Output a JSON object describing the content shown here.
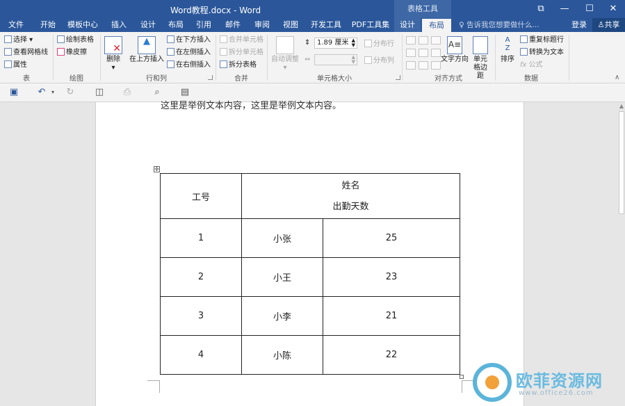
{
  "window": {
    "title": "Word教程.docx - Word",
    "context_group": "表格工具",
    "controls": [
      "ribbon-display-icon",
      "minimize-icon",
      "maximize-icon",
      "close-icon"
    ]
  },
  "tabs": [
    {
      "label": "文件"
    },
    {
      "label": "开始"
    },
    {
      "label": "模板中心"
    },
    {
      "label": "插入"
    },
    {
      "label": "设计"
    },
    {
      "label": "布局"
    },
    {
      "label": "引用"
    },
    {
      "label": "邮件"
    },
    {
      "label": "审阅"
    },
    {
      "label": "视图"
    },
    {
      "label": "开发工具"
    },
    {
      "label": "PDF工具集"
    },
    {
      "label": "设计"
    },
    {
      "label": "布局"
    }
  ],
  "tell_me": "告诉我您想要做什么...",
  "login": "登录",
  "share": "共享",
  "ribbon": {
    "table_group": {
      "label": "表",
      "select": "选择",
      "gridlines": "查看网格线",
      "properties": "属性"
    },
    "draw_group": {
      "label": "绘图",
      "draw_table": "绘制表格",
      "eraser": "橡皮擦"
    },
    "rows_cols_group": {
      "label": "行和列",
      "delete": "删除",
      "insert_above": "在上方插入",
      "insert_below": "在下方插入",
      "insert_left": "在左侧插入",
      "insert_right": "在右侧插入"
    },
    "merge_group": {
      "label": "合并",
      "merge_cells": "合并单元格",
      "split_cells": "拆分单元格",
      "split_table": "拆分表格"
    },
    "cell_size_group": {
      "label": "单元格大小",
      "autofit": "自动调整",
      "height": "1.89 厘米",
      "width": "",
      "distribute_rows": "分布行",
      "distribute_cols": "分布列"
    },
    "alignment_group": {
      "label": "对齐方式",
      "text_direction": "文字方向",
      "cell_margins": "单元格边距"
    },
    "data_group": {
      "label": "数据",
      "sort": "排序",
      "repeat_header": "重复标题行",
      "convert_text": "转换为文本",
      "formula": "公式"
    }
  },
  "document": {
    "top_line": "这里是举例文本内容，这里是举例文本内容。",
    "table": {
      "header_col1": "工号",
      "header_line1": "姓名",
      "header_line2": "出勤天数",
      "rows": [
        {
          "id": "1",
          "name": "小张",
          "days": "25"
        },
        {
          "id": "2",
          "name": "小王",
          "days": "23"
        },
        {
          "id": "3",
          "name": "小李",
          "days": "21"
        },
        {
          "id": "4",
          "name": "小陈",
          "days": "22"
        }
      ]
    }
  },
  "watermark": {
    "text": "欧菲资源网",
    "url": "www.office26.com"
  }
}
